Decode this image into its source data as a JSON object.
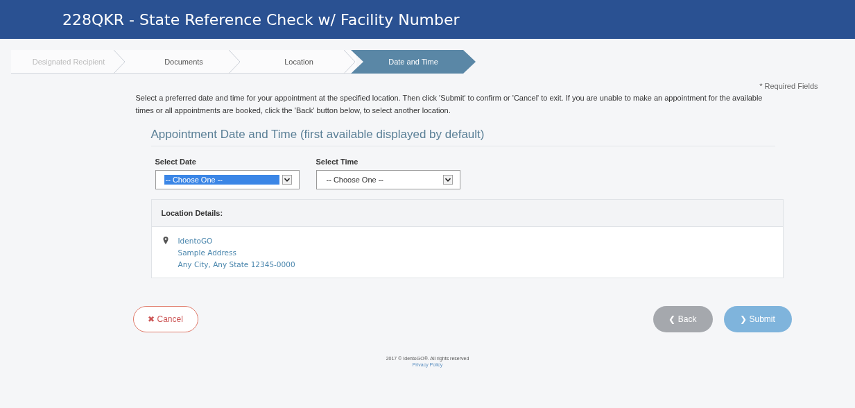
{
  "header": {
    "title": "228QKR - State Reference Check w/ Facility Number"
  },
  "steps": [
    {
      "label": "Designated Recipient",
      "selected": false,
      "disabled": true
    },
    {
      "label": "Documents",
      "selected": false,
      "disabled": false
    },
    {
      "label": "Location",
      "selected": false,
      "disabled": false
    },
    {
      "label": "Date and Time",
      "selected": true,
      "disabled": false
    }
  ],
  "required_note": "* Required Fields",
  "instructions": "Select a preferred date and time for your appointment at the specified location. Then click 'Submit' to confirm or 'Cancel' to exit. If you are unable to make an appointment for the available times or all appointments are booked, click the 'Back' button below, to select another location.",
  "section_title": "Appointment Date and Time (first available displayed by default)",
  "selects": [
    {
      "label": "Select Date",
      "value": "-- Choose One --",
      "selected": true
    },
    {
      "label": "Select Time",
      "value": "-- Choose One --",
      "selected": false
    }
  ],
  "location": {
    "title": "Location Details:",
    "lines": [
      "IdentoGO",
      "Sample Address",
      "Any City, Any State 12345-0000"
    ]
  },
  "buttons": [
    {
      "kind": "cancel",
      "icon": "✖",
      "label": "Cancel"
    },
    {
      "kind": "back",
      "icon": "❮",
      "label": "Back"
    },
    {
      "kind": "submit",
      "icon": "❯",
      "label": "Submit"
    }
  ],
  "footer": {
    "copyright": "2017 © IdentoGO®. All rights reserved",
    "link": "Privacy Policy"
  }
}
